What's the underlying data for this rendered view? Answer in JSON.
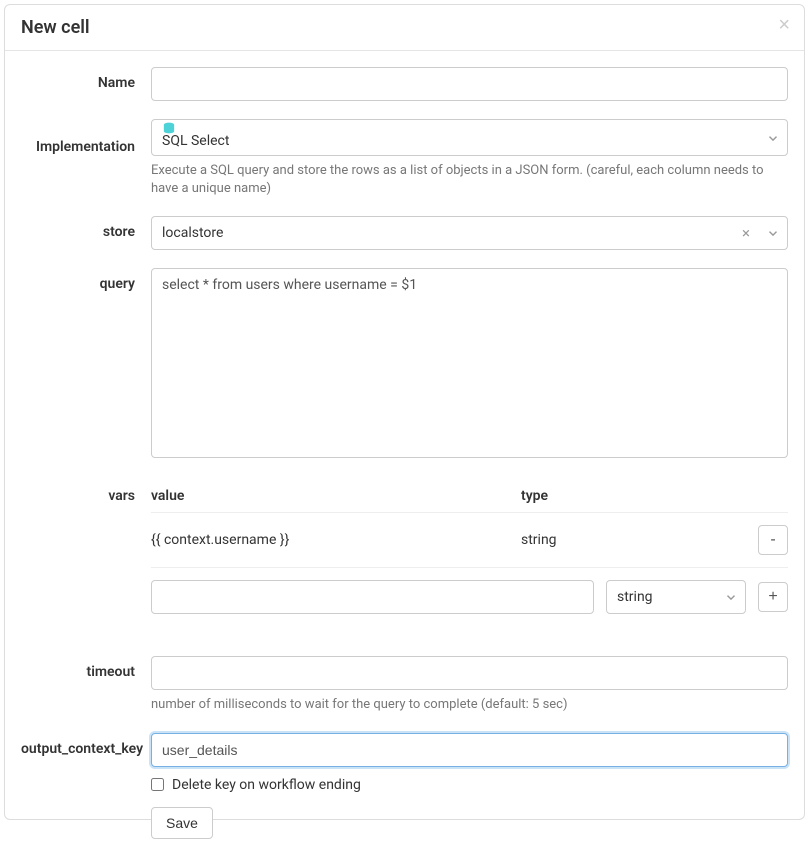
{
  "modal": {
    "title": "New cell"
  },
  "form": {
    "name": {
      "label": "Name",
      "value": ""
    },
    "implementation": {
      "label": "Implementation",
      "selected": "SQL Select",
      "help": "Execute a SQL query and store the rows as a list of objects in a JSON form. (careful, each column needs to have a unique name)"
    },
    "store": {
      "label": "store",
      "selected": "localstore"
    },
    "query": {
      "label": "query",
      "value": "select * from users where username = $1"
    },
    "vars": {
      "label": "vars",
      "headers": {
        "value": "value",
        "type": "type"
      },
      "rows": [
        {
          "value": "{{ context.username }}",
          "type": "string"
        }
      ],
      "new_row": {
        "value": "",
        "type": "string"
      },
      "remove_btn": "-",
      "add_btn": "+"
    },
    "timeout": {
      "label": "timeout",
      "value": "",
      "help": "number of milliseconds to wait for the query to complete (default: 5 sec)"
    },
    "output_context_key": {
      "label": "output_context_key",
      "value": "user_details"
    },
    "delete_key": {
      "label": "Delete key on workflow ending",
      "checked": false
    },
    "save_btn": "Save"
  }
}
